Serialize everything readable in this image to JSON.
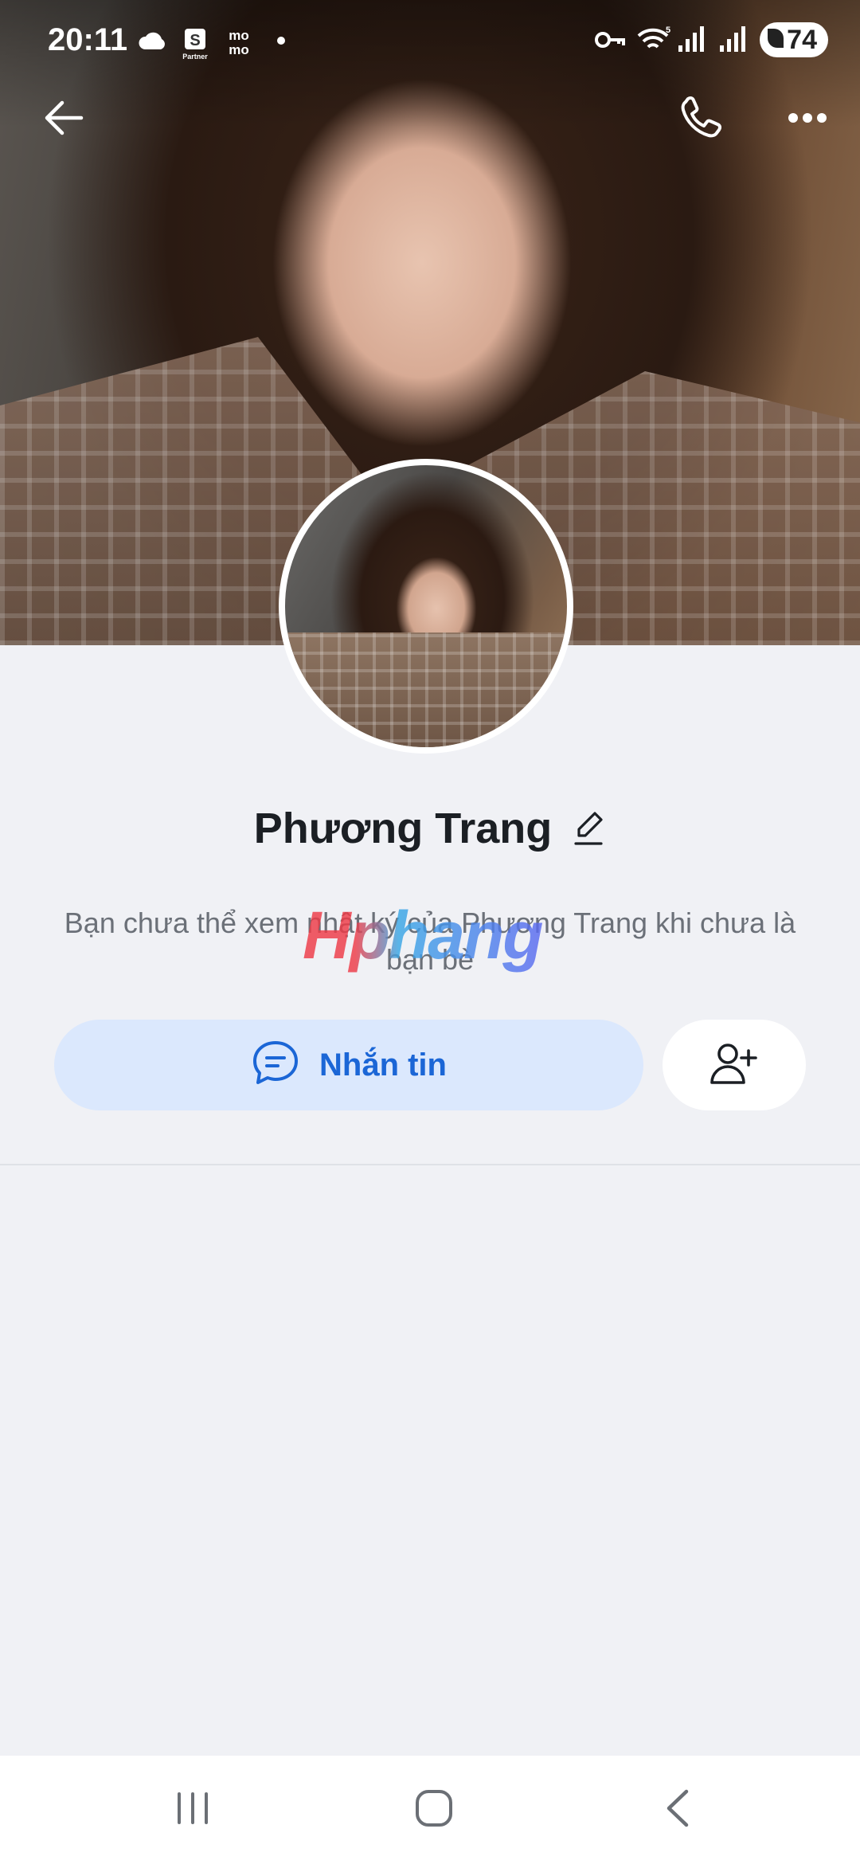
{
  "status_bar": {
    "time": "20:11",
    "left_icons": [
      "cloud-icon",
      "shopee-partner-icon",
      "momo-icon",
      "dot-icon"
    ],
    "right_icons": [
      "vpn-key-icon",
      "wifi-icon",
      "signal-icon",
      "signal-icon"
    ],
    "battery": "74"
  },
  "header": {
    "back_icon": "arrow-left-icon",
    "call_icon": "phone-icon",
    "more_icon": "more-dots-icon"
  },
  "profile": {
    "name": "Phương Trang",
    "edit_icon": "pencil-icon",
    "description": "Bạn chưa thể xem nhật ký của Phương Trang khi chưa là bạn bè",
    "watermark": "Hphang"
  },
  "actions": {
    "message_label": "Nhắn tin",
    "message_icon": "chat-bubble-icon",
    "add_friend_icon": "add-user-icon"
  },
  "colors": {
    "accent": "#1b66d6",
    "message_button_bg": "#dbe8fd",
    "page_bg": "#f0f1f5"
  },
  "nav_bar": {
    "recents_icon": "recents-icon",
    "home_icon": "home-icon",
    "back_icon": "back-chevron-icon"
  }
}
